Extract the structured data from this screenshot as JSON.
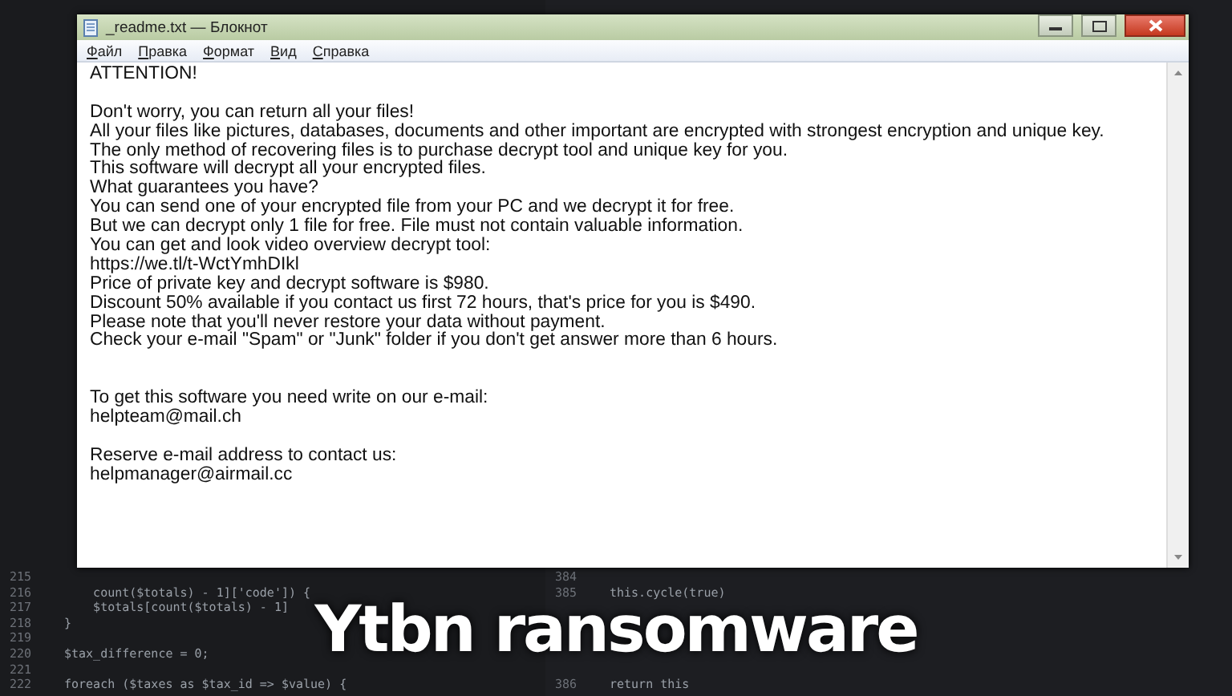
{
  "background_code": {
    "left": [
      {
        "number": "215"
      },
      {
        "number": "216",
        "code": "    count($totals) - 1]['code']) {"
      },
      {
        "number": "217",
        "code": "    $totals[count($totals) - 1]"
      },
      {
        "number": "218",
        "code": "}"
      },
      {
        "number": "219"
      },
      {
        "number": "220",
        "code": "$tax_difference = 0;"
      },
      {
        "number": "221"
      },
      {
        "number": "222",
        "code": "foreach ($taxes as $tax_id => $value) {"
      }
    ],
    "right_top": [
      {
        "number": "384"
      },
      {
        "number": "385",
        "code": "this.cycle(true)"
      }
    ],
    "right_bottom": [
      {
        "number": "386",
        "code": "return this"
      }
    ]
  },
  "window": {
    "title": "_readme.txt — Блокнот"
  },
  "menu": [
    "Файл",
    "Правка",
    "Формат",
    "Вид",
    "Справка"
  ],
  "document": "ATTENTION!\n\nDon't worry, you can return all your files!\nAll your files like pictures, databases, documents and other important are encrypted with strongest encryption and unique key.\nThe only method of recovering files is to purchase decrypt tool and unique key for you.\nThis software will decrypt all your encrypted files.\nWhat guarantees you have?\nYou can send one of your encrypted file from your PC and we decrypt it for free.\nBut we can decrypt only 1 file for free. File must not contain valuable information.\nYou can get and look video overview decrypt tool:\nhttps://we.tl/t-WctYmhDIkl\nPrice of private key and decrypt software is $980.\nDiscount 50% available if you contact us first 72 hours, that's price for you is $490.\nPlease note that you'll never restore your data without payment.\nCheck your e-mail \"Spam\" or \"Junk\" folder if you don't get answer more than 6 hours.\n\n\nTo get this software you need write on our e-mail:\nhelpteam@mail.ch\n\nReserve e-mail address to contact us:\nhelpmanager@airmail.cc",
  "caption": "Ytbn ransomware"
}
